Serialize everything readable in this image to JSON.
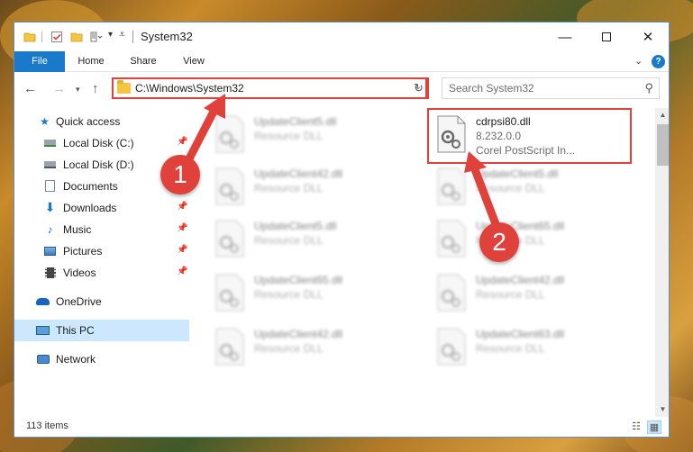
{
  "window": {
    "title": "System32"
  },
  "titlebar": {
    "quick_access_icons": [
      "folder-icon",
      "properties-check-icon",
      "new-folder-icon",
      "customize-icon"
    ],
    "buttons": [
      "minimize",
      "maximize",
      "close"
    ]
  },
  "ribbon": {
    "tabs": [
      {
        "label": "File",
        "active": true
      },
      {
        "label": "Home"
      },
      {
        "label": "Share"
      },
      {
        "label": "View"
      }
    ]
  },
  "navigation": {
    "address": "C:\\Windows\\System32",
    "search_placeholder": "Search System32"
  },
  "sidebar": {
    "items": [
      {
        "label": "Quick access",
        "icon": "star-icon",
        "pinned": false,
        "indent": 1
      },
      {
        "label": "Local Disk (C:)",
        "icon": "drive-icon",
        "pinned": true,
        "indent": 2
      },
      {
        "label": "Local Disk (D:)",
        "icon": "drive-icon",
        "pinned": true,
        "indent": 2
      },
      {
        "label": "Documents",
        "icon": "documents-icon",
        "pinned": true,
        "indent": 2
      },
      {
        "label": "Downloads",
        "icon": "downloads-icon",
        "pinned": true,
        "indent": 2
      },
      {
        "label": "Music",
        "icon": "music-icon",
        "pinned": true,
        "indent": 2
      },
      {
        "label": "Pictures",
        "icon": "pictures-icon",
        "pinned": true,
        "indent": 2
      },
      {
        "label": "Videos",
        "icon": "videos-icon",
        "pinned": true,
        "indent": 2
      },
      {
        "label": "OneDrive",
        "icon": "onedrive-icon",
        "pinned": false,
        "indent": 1
      },
      {
        "label": "This PC",
        "icon": "this-pc-icon",
        "pinned": false,
        "indent": 1,
        "selected": true
      },
      {
        "label": "Network",
        "icon": "network-icon",
        "pinned": false,
        "indent": 1
      }
    ]
  },
  "files": {
    "left_column": [
      {
        "name": "UpdateClient5.dll",
        "type": "Resource DLL"
      },
      {
        "name": "UpdateClient42.dll",
        "type": "Resource DLL"
      },
      {
        "name": "UpdateClient5.dll",
        "type": "Resource DLL"
      },
      {
        "name": "UpdateClient65.dll",
        "type": "Resource DLL"
      },
      {
        "name": "UpdateClient42.dll",
        "type": "Resource DLL"
      }
    ],
    "right_column": [
      {
        "name": "cdrpsi80.dll",
        "version": "8.232.0.0",
        "description": "Corel PostScript In...",
        "highlighted": true
      },
      {
        "name": "UpdateClient5.dll",
        "type": "Resource DLL"
      },
      {
        "name": "UpdateClient65.dll",
        "type": "Resource DLL"
      },
      {
        "name": "UpdateClient42.dll",
        "type": "Resource DLL"
      },
      {
        "name": "UpdateClient63.dll",
        "type": "Resource DLL"
      }
    ]
  },
  "status": {
    "item_count": "113 items"
  },
  "callouts": [
    {
      "label": "1"
    },
    {
      "label": "2"
    }
  ],
  "colors": {
    "accent": "#1979ca",
    "callout": "#e0413a",
    "selection": "#cce8ff"
  }
}
